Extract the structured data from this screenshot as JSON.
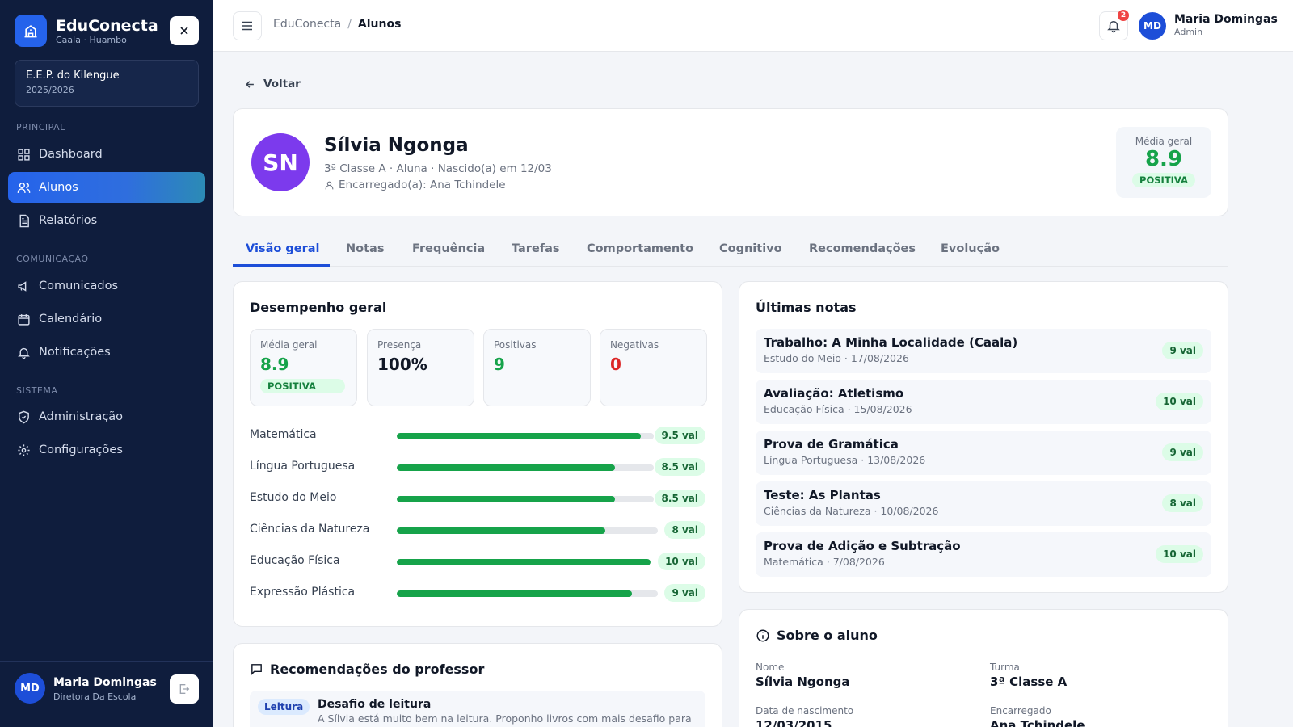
{
  "sidebar": {
    "brand_name": "EduConecta",
    "brand_sub": "Caala · Huambo",
    "school_name": "E.E.P. do Kilengue",
    "school_year": "2025/2026",
    "sections": {
      "principal": "PRINCIPAL",
      "comunicacao": "COMUNICAÇÃO",
      "sistema": "SISTEMA"
    },
    "items": {
      "dashboard": "Dashboard",
      "alunos": "Alunos",
      "relatorios": "Relatórios",
      "comunicados": "Comunicados",
      "calendario": "Calendário",
      "notificacoes": "Notificações",
      "administracao": "Administração",
      "configuracoes": "Configurações"
    },
    "user": {
      "initials": "MD",
      "name": "Maria Domingas",
      "role": "Diretora Da Escola"
    }
  },
  "topbar": {
    "breadcrumb_root": "EduConecta",
    "breadcrumb_sep": "/",
    "breadcrumb_current": "Alunos",
    "notification_count": "2",
    "user": {
      "initials": "MD",
      "name": "Maria Domingas",
      "role": "Admin"
    }
  },
  "back_label": "Voltar",
  "student": {
    "initials": "SN",
    "name": "Sílvia Ngonga",
    "info": "3ª Classe A · Aluna · Nascido(a) em 12/03",
    "guardian": "Encarregado(a): Ana Tchindele",
    "mean_label": "Média geral",
    "mean_value": "8.9",
    "mean_status": "POSITIVA"
  },
  "tabs": [
    "Visão geral",
    "Notas",
    "Frequência",
    "Tarefas",
    "Comportamento",
    "Cognitivo",
    "Recomendações",
    "Evolução"
  ],
  "performance": {
    "title": "Desempenho geral",
    "stats": [
      {
        "label": "Média geral",
        "value": "8.9",
        "badge": "POSITIVA"
      },
      {
        "label": "Presença",
        "value": "100%"
      },
      {
        "label": "Positivas",
        "value": "9"
      },
      {
        "label": "Negativas",
        "value": "0"
      }
    ],
    "subjects": [
      {
        "name": "Matemática",
        "grade": "9.5 val",
        "fraction": 0.95
      },
      {
        "name": "Língua Portuguesa",
        "grade": "8.5 val",
        "fraction": 0.85
      },
      {
        "name": "Estudo do Meio",
        "grade": "8.5 val",
        "fraction": 0.85
      },
      {
        "name": "Ciências da Natureza",
        "grade": "8 val",
        "fraction": 0.8
      },
      {
        "name": "Educação Física",
        "grade": "10 val",
        "fraction": 1.0
      },
      {
        "name": "Expressão Plástica",
        "grade": "9 val",
        "fraction": 0.9
      }
    ]
  },
  "latest": {
    "title": "Últimas notas",
    "items": [
      {
        "title": "Trabalho: A Minha Localidade (Caala)",
        "meta": "Estudo do Meio · 17/08/2026",
        "value": "9 val"
      },
      {
        "title": "Avaliação: Atletismo",
        "meta": "Educação Física · 15/08/2026",
        "value": "10 val"
      },
      {
        "title": "Prova de Gramática",
        "meta": "Língua Portuguesa · 13/08/2026",
        "value": "9 val"
      },
      {
        "title": "Teste: As Plantas",
        "meta": "Ciências da Natureza · 10/08/2026",
        "value": "8 val"
      },
      {
        "title": "Prova de Adição e Subtração",
        "meta": "Matemática · 7/08/2026",
        "value": "10 val"
      }
    ]
  },
  "recommendations": {
    "title": "Recomendações do professor",
    "item": {
      "tag": "Leitura",
      "title": "Desafio de leitura",
      "text": "A Sílvia está muito bem na leitura. Proponho livros com mais desafio para"
    }
  },
  "about": {
    "title": "Sobre o aluno",
    "fields": [
      {
        "label": "Nome",
        "value": "Sílvia Ngonga"
      },
      {
        "label": "Turma",
        "value": "3ª Classe A"
      },
      {
        "label": "Data de nascimento",
        "value": "12/03/2015"
      },
      {
        "label": "Encarregado",
        "value": "Ana Tchindele"
      }
    ]
  },
  "colors": {
    "primary": "#2563eb",
    "sidebar": "#0f1d3d",
    "positive": "#16a34a",
    "negative": "#dc2626",
    "avatar_student": "#7c3aed"
  }
}
